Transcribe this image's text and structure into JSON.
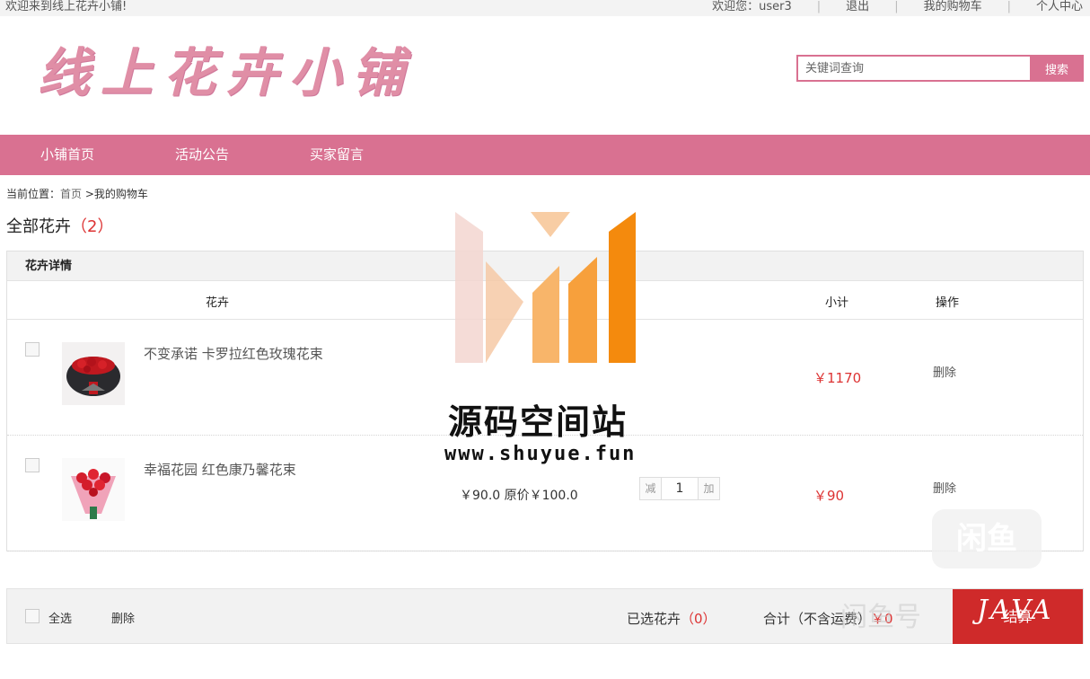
{
  "topbar": {
    "welcome": "欢迎来到线上花卉小铺!",
    "user_greeting": "欢迎您：user3",
    "logout": "退出",
    "my_cart": "我的购物车",
    "personal_center": "个人中心"
  },
  "header": {
    "logo_text": "线上花卉小铺",
    "search_placeholder": "关键词查询",
    "search_button": "搜索"
  },
  "nav": {
    "items": [
      "小铺首页",
      "活动公告",
      "买家留言"
    ]
  },
  "breadcrumb": {
    "prefix": "当前位置：",
    "home": "首页",
    "current": ">我的购物车"
  },
  "section": {
    "title": "全部花卉",
    "count": "（2）"
  },
  "cart": {
    "head_title": "花卉详情",
    "columns": {
      "flower": "花卉",
      "subtotal": "小计",
      "operation": "操作"
    },
    "items": [
      {
        "name": "不变承诺 卡罗拉红色玫瑰花束",
        "subtotal": "￥1170",
        "delete": "删除"
      },
      {
        "name": "幸福花园 红色康乃馨花束",
        "price": "￥90.0 原价￥100.0",
        "qty_minus": "减",
        "qty": "1",
        "qty_plus": "加",
        "subtotal": "￥90",
        "delete": "删除"
      }
    ]
  },
  "bottombar": {
    "select_all": "全选",
    "delete": "删除",
    "selected_label": "已选花卉",
    "selected_count": "（0）",
    "total_label": "合计（不含运费）",
    "total_value": "￥0",
    "checkout": "结算"
  },
  "watermark": {
    "site_name": "源码空间站",
    "site_url": "www.shuyue.fun",
    "badge": "闲鱼",
    "badge_text": "闲鱼号",
    "java": "JAVA"
  },
  "colors": {
    "brand_pink": "#d97191",
    "price_red": "#d33333",
    "checkout_red": "#cf2a2a"
  }
}
